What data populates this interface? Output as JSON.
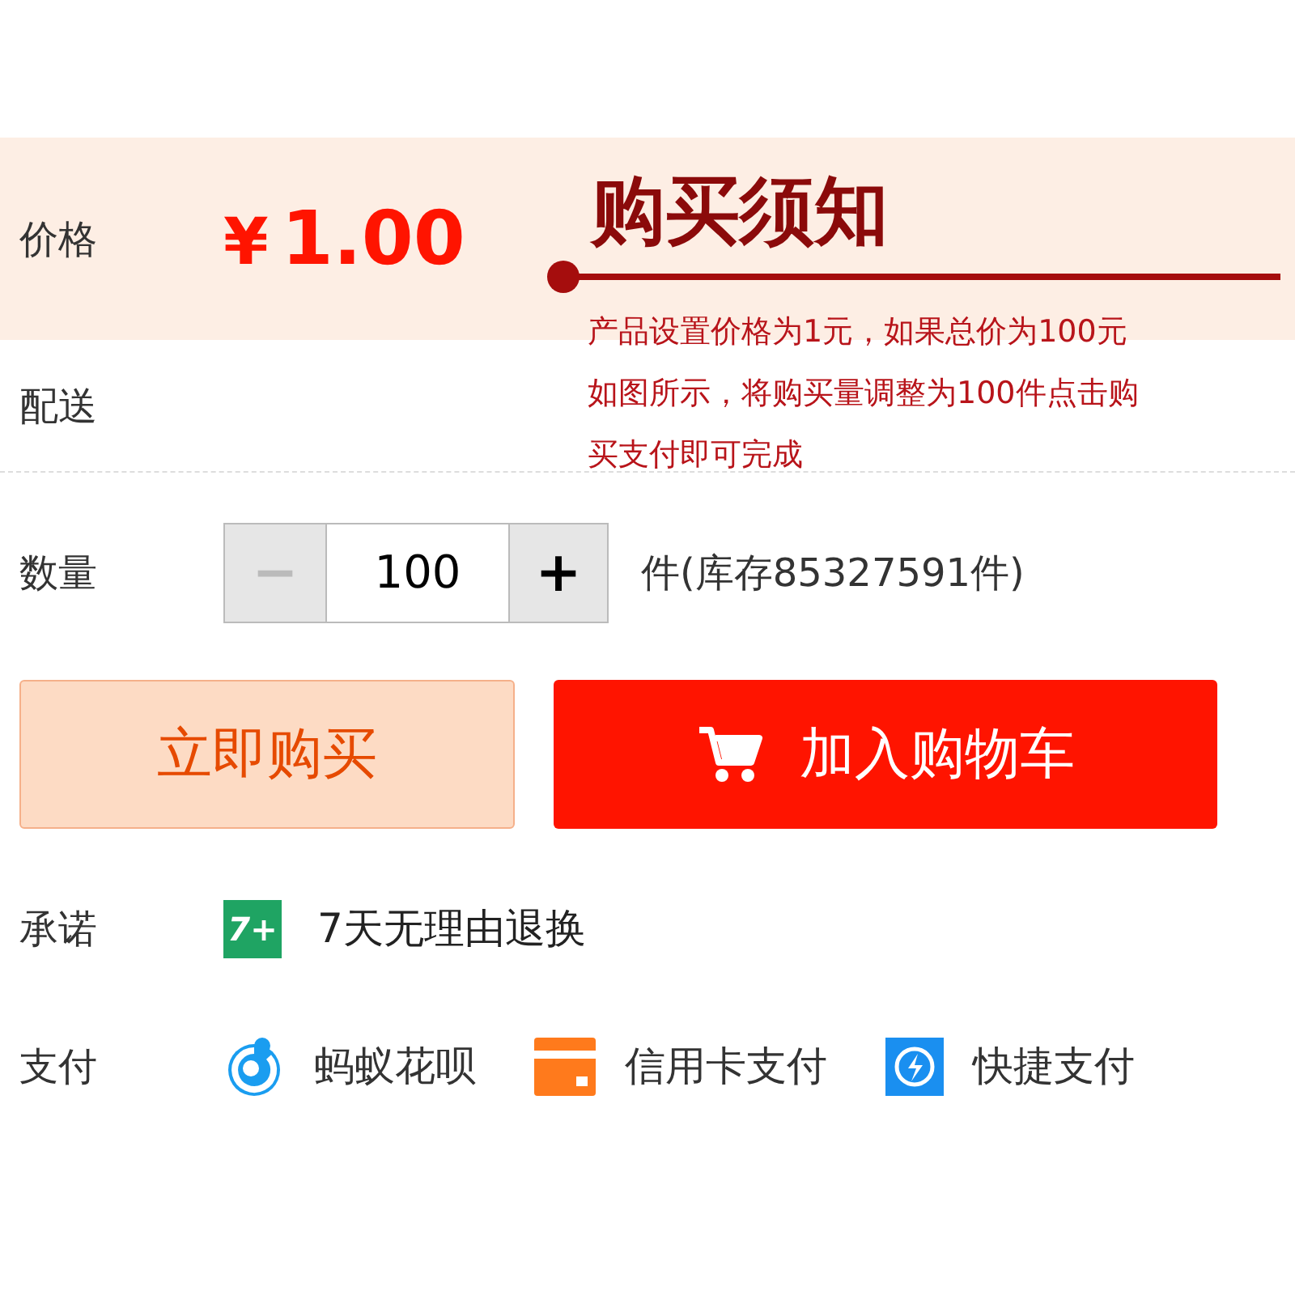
{
  "price": {
    "label": "价格",
    "currency": "¥",
    "amount": "1.00"
  },
  "delivery": {
    "label": "配送"
  },
  "quantity": {
    "label": "数量",
    "decrement": "−",
    "decrement_disabled": true,
    "value": "100",
    "increment": "+",
    "unit_stock": "件(库存85327591件)"
  },
  "buttons": [
    {
      "kind": "buy",
      "label": "立即购买"
    },
    {
      "kind": "cart",
      "label": "加入购物车"
    }
  ],
  "promise": {
    "label": "承诺",
    "badge": "7+",
    "text": "7天无理由退换"
  },
  "payment": {
    "label": "支付",
    "methods": [
      {
        "kind": "huabei",
        "label": "蚂蚁花呗"
      },
      {
        "kind": "card",
        "label": "信用卡支付"
      },
      {
        "kind": "express",
        "label": "快捷支付"
      }
    ]
  },
  "notice": {
    "title": "购买须知",
    "lines": [
      "产品设置价格为1元，如果总价为100元",
      "如图所示，将购买量调整为100件点击购",
      "买支付即可完成"
    ]
  }
}
